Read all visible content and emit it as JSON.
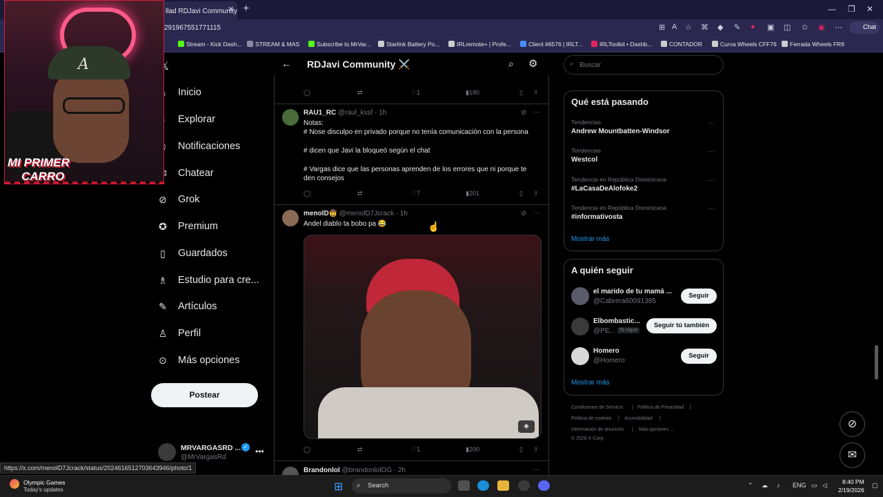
{
  "browser": {
    "tab_title": "llad RDJavi Community ⚔️",
    "tab_close": "✕",
    "new_tab": "+",
    "url": "291967551771115",
    "chat_label": "Chat",
    "window_controls": [
      "—",
      "❐",
      "✕"
    ],
    "bookmarks": [
      {
        "label": "Stream - Kick Dash...",
        "color": "#53fc18"
      },
      {
        "label": "STREAM & MAS",
        "color": "#8a8aa8"
      },
      {
        "label": "Subscribe to MrVar...",
        "color": "#53fc18"
      },
      {
        "label": "Starlink Battery Po...",
        "color": "#cccccc"
      },
      {
        "label": "IRLremote+ | Profe...",
        "color": "#cccccc"
      },
      {
        "label": "Client #6576 | IRLT...",
        "color": "#4a8cff"
      },
      {
        "label": "IRLToolkit • Dashb...",
        "color": "#e0245e"
      },
      {
        "label": "CONTADOR",
        "color": "#cccccc"
      },
      {
        "label": "Curva Wheels CFF76",
        "color": "#cccccc"
      },
      {
        "label": "Ferrada Wheels FR9",
        "color": "#cccccc"
      }
    ]
  },
  "stream_overlay": {
    "banner_line1": "MI PRIMER",
    "banner_line2": "CARRO"
  },
  "nav": {
    "items": [
      {
        "label": "Inicio",
        "icon": "home-icon"
      },
      {
        "label": "Explorar",
        "icon": "search-icon"
      },
      {
        "label": "Notificaciones",
        "icon": "bell-icon"
      },
      {
        "label": "Chatear",
        "icon": "mail-icon"
      },
      {
        "label": "Grok",
        "icon": "grok-icon"
      },
      {
        "label": "Premium",
        "icon": "premium-icon"
      },
      {
        "label": "Guardados",
        "icon": "bookmark-icon"
      },
      {
        "label": "Estudio para cre...",
        "icon": "studio-icon"
      },
      {
        "label": "Artículos",
        "icon": "article-icon"
      },
      {
        "label": "Perfil",
        "icon": "profile-icon"
      },
      {
        "label": "Más opciones",
        "icon": "more-icon"
      }
    ],
    "post_label": "Postear",
    "account_name": "MRVARGASRD ...",
    "account_handle": "@MrVargasRd"
  },
  "community": {
    "title": "RDJavi Community ⚔️"
  },
  "tweets": [
    {
      "likes": "1",
      "views": "180"
    },
    {
      "name": "RAU1_RC",
      "handle_time": "@raul_kssf · 1h",
      "lines": [
        "Notas:",
        "# Nose disculpo en privado porque no tenía comunicación con la persona",
        "",
        "# dicen que Javi la bloqueó según el chat",
        "",
        "# Vargas dice que las personas aprenden de los errores que ni porque te",
        "den consejos"
      ],
      "likes": "7",
      "views": "201"
    },
    {
      "name": "menolD🤠",
      "handle_time": "@menolD7Jcrack · 1h",
      "lines": [
        "Andel diablo ta bobo pa 😂"
      ],
      "likes": "1",
      "views": "200"
    },
    {
      "name": "Brandonlol",
      "handle_time": "@brandonlolOG · 2h"
    }
  ],
  "right": {
    "search_placeholder": "Buscar",
    "trends_title": "Qué está pasando",
    "trends": [
      {
        "category": "Tendencias",
        "name": "Andrew Mountbatten-Windsor"
      },
      {
        "category": "Tendencias",
        "name": "Westcol"
      },
      {
        "category": "Tendencia en República Dominicana",
        "name": "#LaCasaDeAlofoke2"
      },
      {
        "category": "Tendencia en República Dominicana",
        "name": "#informativosta"
      }
    ],
    "show_more": "Mostrar más",
    "follow_title": "A quién seguir",
    "follow": [
      {
        "name": "el marido de tu mamá ...",
        "handle": "@Cabrera60091385",
        "button": "Seguir"
      },
      {
        "name": "Elbombastic...",
        "handle": "@PE...",
        "badge": "Te sigue",
        "button": "Seguir tú también"
      },
      {
        "name": "Homero",
        "handle": "@Homero",
        "button": "Seguir"
      }
    ],
    "footer": [
      "Condiciones de Servicio",
      "|",
      "Política de Privacidad",
      "|",
      "Política de cookies",
      "|",
      "Accesibilidad",
      "|",
      "Información de anuncios",
      "|",
      "Más opciones ...",
      "© 2026 X Corp."
    ]
  },
  "status_url": "https://x.com/menolD7Jcrack/status/2024616512703643946/photo/1",
  "taskbar": {
    "weather_title": "Olympic Games",
    "weather_sub": "Today's updates",
    "search_label": "Search",
    "lang": "ENG",
    "time": "8:40 PM",
    "date": "2/19/2026"
  }
}
